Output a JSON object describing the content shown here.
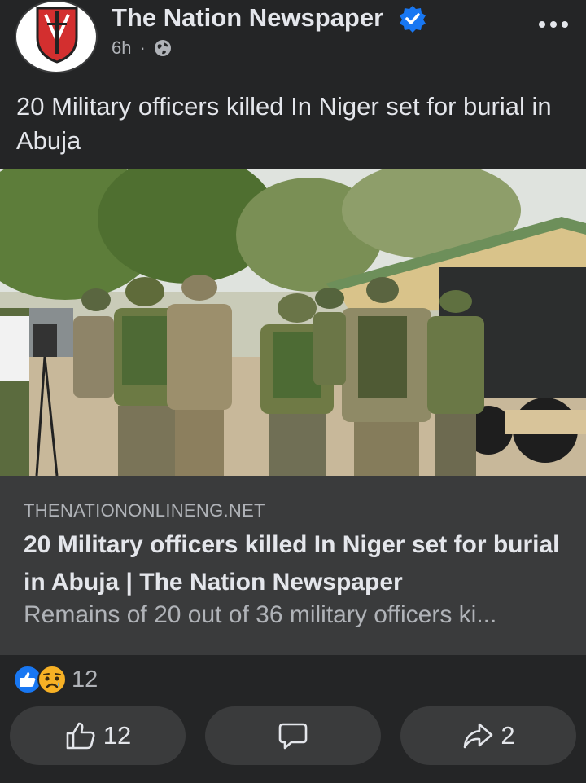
{
  "post": {
    "page_name": "The Nation Newspaper",
    "time": "6h",
    "separator": "·",
    "text": "20 Military officers killed In Niger set for burial in Abuja"
  },
  "link": {
    "domain": "THENATIONONLINENG.NET",
    "title": "20 Military officers killed In Niger set for burial in Abuja | The Nation Newspaper",
    "description": "Remains of 20 out of 36 military officers ki..."
  },
  "reactions": {
    "count": "12",
    "types": [
      "like-icon",
      "sad-icon"
    ]
  },
  "actions": {
    "like_count": "12",
    "share_count": "2"
  },
  "colors": {
    "background": "#242526",
    "card": "#3a3b3c",
    "verified": "#1877f2"
  }
}
